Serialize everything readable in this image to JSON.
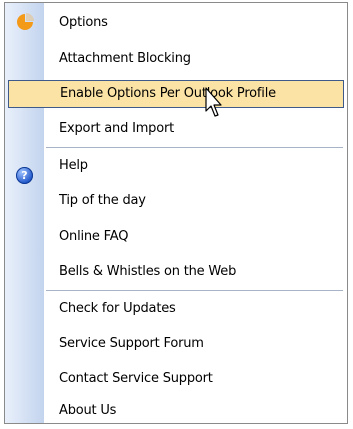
{
  "menu": {
    "items": [
      {
        "label": "Options"
      },
      {
        "label": "Attachment Blocking"
      },
      {
        "label": "Enable Options Per Outlook Profile",
        "highlighted": true
      },
      {
        "label": "Export and Import"
      },
      {
        "label": "Help"
      },
      {
        "label": "Tip of the day"
      },
      {
        "label": "Online FAQ"
      },
      {
        "label": "Bells & Whistles on the Web"
      },
      {
        "label": "Check for Updates"
      },
      {
        "label": "Service Support Forum"
      },
      {
        "label": "Contact Service Support"
      },
      {
        "label": "About Us"
      }
    ]
  },
  "icons": {
    "logo": "app-logo-icon",
    "help": "help-icon",
    "cursor": "mouse-cursor-icon",
    "help_glyph": "?"
  },
  "colors": {
    "highlight_fill": "#fbe3a6",
    "highlight_border": "#3e5a8a",
    "gutter": "#c3d4ee",
    "logo_orange": "#f39a18"
  }
}
